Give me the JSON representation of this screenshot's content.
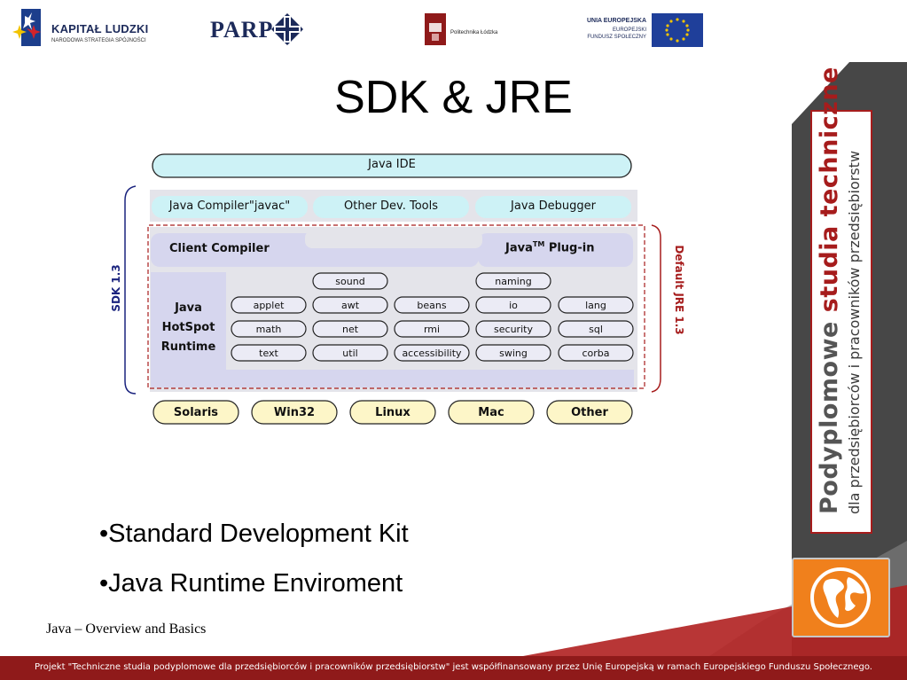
{
  "header": {
    "kapital_title": "KAPITAŁ LUDZKI",
    "kapital_subtitle": "NARODOWA STRATEGIA SPÓJNOŚCI",
    "parp_label": "PARP",
    "politechnika_label": "Politechnika Łódzka",
    "ue_line1": "UNIA EUROPEJSKA",
    "ue_line2": "EUROPEJSKI",
    "ue_line3": "FUNDUSZ SPOŁECZNY"
  },
  "slide": {
    "title": "SDK & JRE",
    "bullets": [
      "•Standard Development Kit",
      "•Java Runtime Enviroment"
    ],
    "footer_label": "Java – Overview and Basics"
  },
  "diagram": {
    "java_ide": "Java IDE",
    "tools": [
      "Java Compiler\"javac\"",
      "Other Dev. Tools",
      "Java Debugger"
    ],
    "client_compiler": "Client Compiler",
    "plugin_java": "Java",
    "plugin_tm": "TM",
    "plugin_label": "Plug-in",
    "runtime_lines": [
      "Java",
      "HotSpot",
      "Runtime"
    ],
    "sdk_label": "SDK 1.3",
    "jre_label": "Default JRE 1.3",
    "libs_row0": [
      "sound",
      "naming"
    ],
    "libs_row1": [
      "applet",
      "awt",
      "beans",
      "io",
      "lang"
    ],
    "libs_row2": [
      "math",
      "net",
      "rmi",
      "security",
      "sql"
    ],
    "libs_row3": [
      "text",
      "util",
      "accessibility",
      "swing",
      "corba"
    ],
    "platforms": [
      "Solaris",
      "Win32",
      "Linux",
      "Mac",
      "Other"
    ],
    "colors": {
      "ide": "#cdf2f6",
      "tools_bg": "#e4e4ea",
      "jre_bg": "#d6d6ee",
      "lib_fill": "#ebebf5",
      "platform_fill": "#fdf6c8",
      "sdk_brace": "#1a237e",
      "jre_brace": "#a61c1c"
    }
  },
  "side_banner": {
    "word1": "Podyplomowe",
    "word2": "studia",
    "word3": "techniczne",
    "line2": "dla przedsiębiorców i pracowników przedsiębiorstw"
  },
  "bottom_bar": {
    "text": "Projekt \"Techniczne studia podyplomowe dla przedsiębiorców i pracowników przedsiębiorstw\" jest współfinansowany przez Unię Europejską w ramach Europejskiego Funduszu Społecznego."
  },
  "icons": {
    "kapital": "kapital-ludzki-star-icon",
    "parp": "parp-diamond-icon",
    "politechnika": "politechnika-crest-icon",
    "eu": "eu-flag-icon",
    "globe": "globe-icon"
  }
}
